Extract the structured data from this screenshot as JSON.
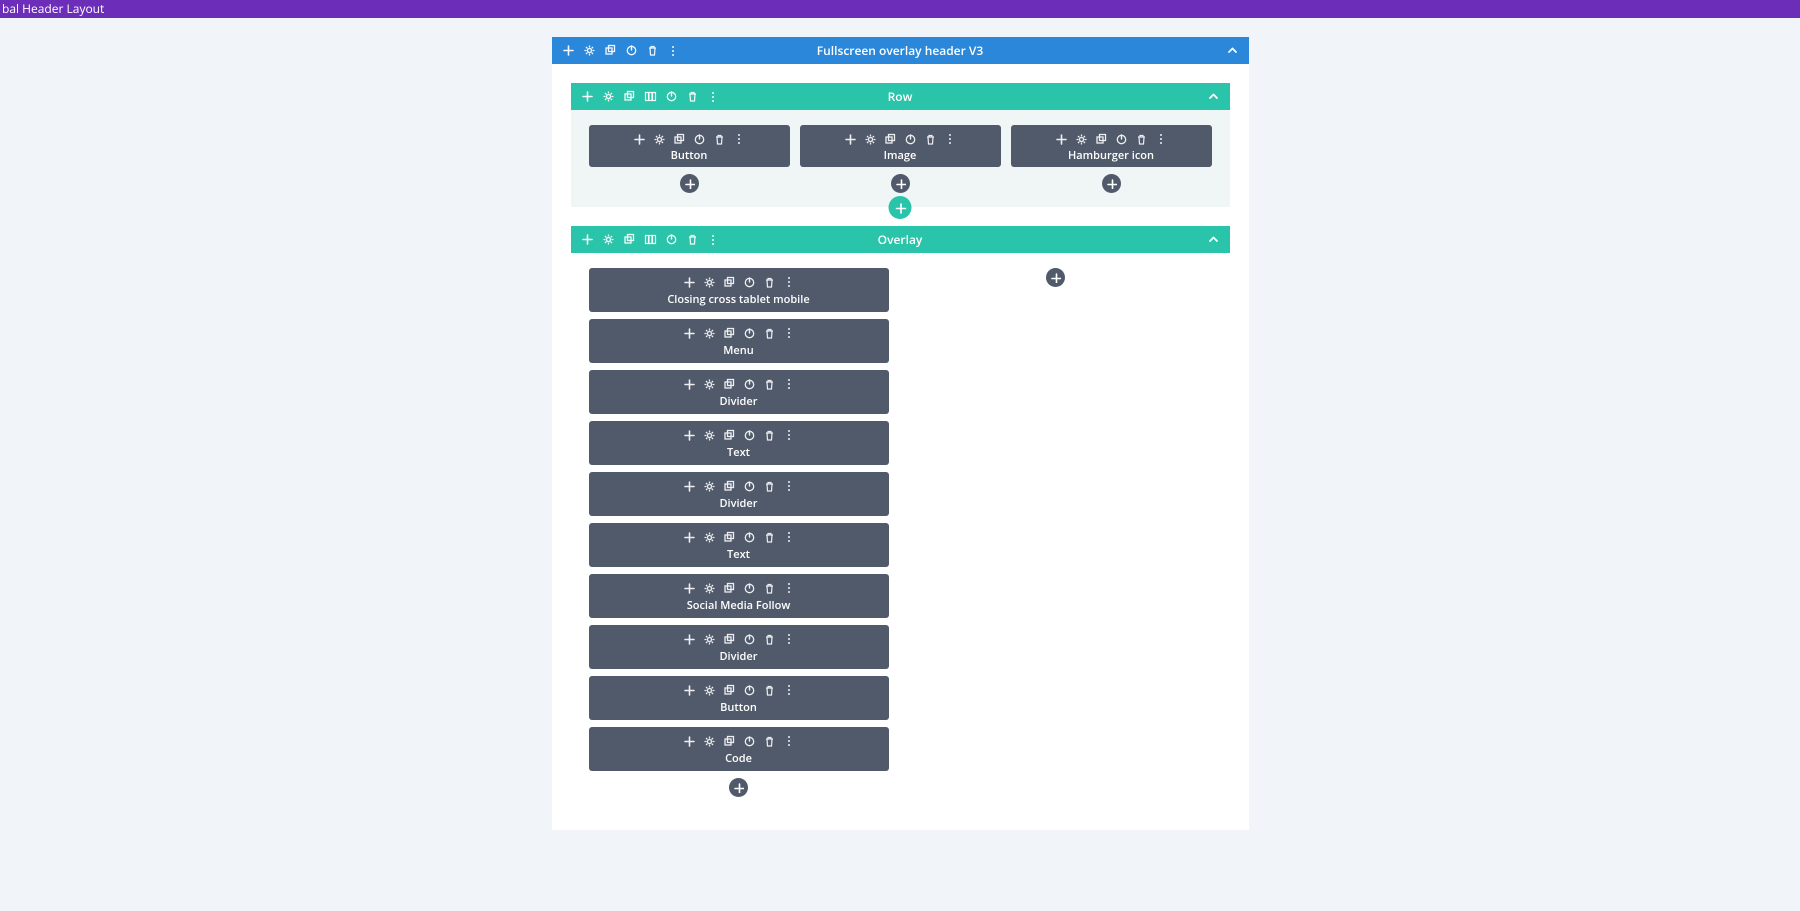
{
  "topbar": {
    "title": "bal Header Layout"
  },
  "section": {
    "title": "Fullscreen overlay header V3"
  },
  "row1": {
    "title": "Row",
    "modules": [
      "Button",
      "Image",
      "Hamburger icon"
    ]
  },
  "row2": {
    "title": "Overlay",
    "modules": [
      "Closing cross tablet mobile",
      "Menu",
      "Divider",
      "Text",
      "Divider",
      "Text",
      "Social Media Follow",
      "Divider",
      "Button",
      "Code"
    ]
  }
}
